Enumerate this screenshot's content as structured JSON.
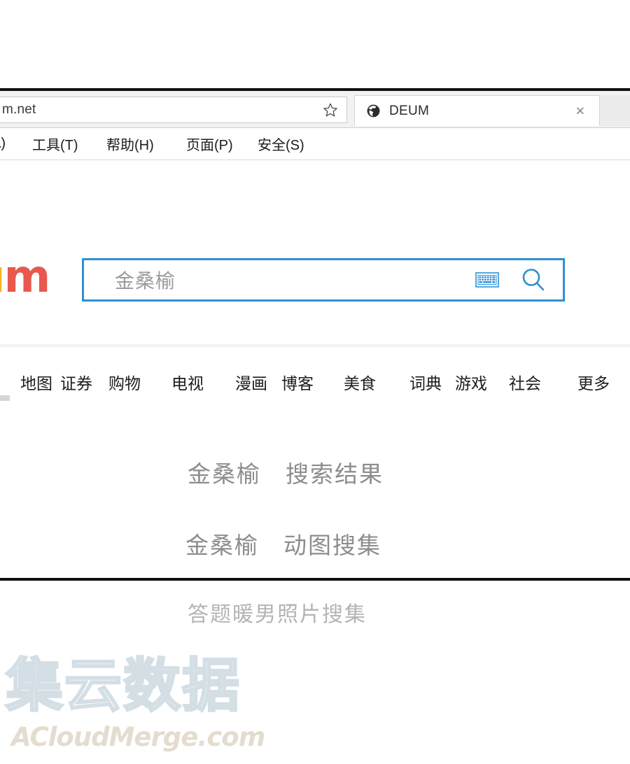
{
  "browser": {
    "address_bar": {
      "value": "m.net",
      "bookmark_icon": "star-icon"
    },
    "tab": {
      "favicon": "globe-icon",
      "title": "DEUM",
      "close_label": "✕"
    },
    "menu_items": [
      {
        "label": "A)"
      },
      {
        "label": "工具(T)"
      },
      {
        "label": "帮助(H)"
      },
      {
        "label": "页面(P)"
      },
      {
        "label": "安全(S)"
      }
    ]
  },
  "page": {
    "logo": {
      "part_yellow": "u",
      "part_red": "m"
    },
    "search": {
      "value": "金桑榆",
      "placeholder": "金桑榆",
      "keyboard_icon": "keyboard-icon",
      "search_icon": "magnifier-icon",
      "border_color": "#2e90d4"
    },
    "nav_items": [
      {
        "label": "地图"
      },
      {
        "label": "证券"
      },
      {
        "label": "购物"
      },
      {
        "label": "电视"
      },
      {
        "label": "漫画"
      },
      {
        "label": "博客"
      },
      {
        "label": "美食"
      },
      {
        "label": "词典"
      },
      {
        "label": "游戏"
      },
      {
        "label": "社会"
      },
      {
        "label": "更多"
      }
    ],
    "suggestions": [
      {
        "label": "金桑榆　搜索结果"
      },
      {
        "label": "金桑榆　动图搜集"
      },
      {
        "label": "答题暖男照片搜集"
      }
    ]
  },
  "watermark": {
    "chinese": "集云数据",
    "latin": "ACloudMerge.com"
  }
}
